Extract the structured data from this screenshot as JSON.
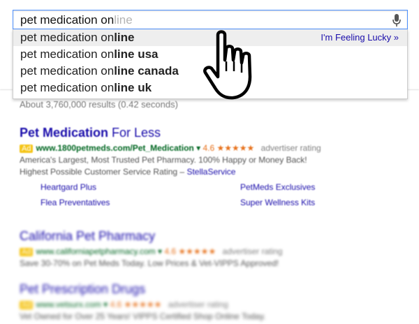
{
  "search": {
    "typed": "pet medication on",
    "ghost": "line"
  },
  "suggestions": [
    {
      "prefix": "pet medication on",
      "bold": "line"
    },
    {
      "prefix": "pet medication on",
      "bold": "line usa"
    },
    {
      "prefix": "pet medication on",
      "bold": "line canada"
    },
    {
      "prefix": "pet medication on",
      "bold": "line uk"
    }
  ],
  "lucky_label": "I'm Feeling Lucky »",
  "stats": "About 3,760,000 results (0.42 seconds)",
  "results": [
    {
      "title_bold": "Pet Medication",
      "title_rest": " For Less",
      "ad_label": "Ad",
      "url": "www.1800petmeds.com/Pet_Medication",
      "rating": "4.6",
      "stars": "★★★★★",
      "rating_text": "advertiser rating",
      "desc1": "America's Largest, Most Trusted Pet Pharmacy. 100% Happy or Money Back!",
      "desc2": "Highest Possible Customer Service Rating –",
      "desc2_link": "StellaService",
      "sitelinks": [
        "Heartgard Plus",
        "PetMeds Exclusives",
        "Flea Preventatives",
        "Super Wellness Kits"
      ]
    },
    {
      "title": "California Pet Pharmacy",
      "ad_label": "Ad",
      "url": "www.californiapetpharmacy.com",
      "rating": "4.6",
      "stars": "★★★★★",
      "rating_text": "advertiser rating",
      "desc1": "Save 30-70% on Pet Meds Today. Low Prices & Vet-VIPPS Approved!"
    },
    {
      "title": "Pet Prescription Drugs",
      "ad_label": "Ad",
      "url": "www.vetsurx.com",
      "rating": "4.6",
      "stars": "★★★★★",
      "rating_text": "advertiser rating",
      "desc1": "Vet Owned for Over 25 Years! VIPPS Certified Shop Online Today."
    }
  ]
}
